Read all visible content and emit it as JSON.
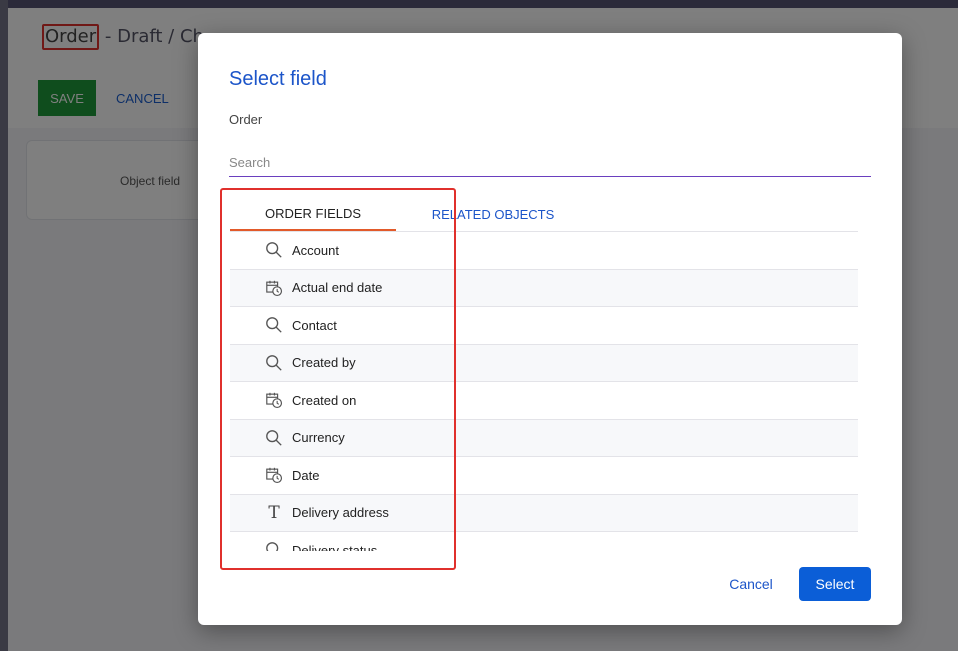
{
  "background": {
    "title_prefix": "Order",
    "title_rest": " - Draft / Ch",
    "save_label": "SAVE",
    "cancel_label": "CANCEL",
    "card_label": "Object field"
  },
  "dialog": {
    "title": "Select field",
    "subtitle": "Order",
    "search_placeholder": "Search",
    "tabs": [
      {
        "label": "ORDER FIELDS",
        "active": true
      },
      {
        "label": "RELATED OBJECTS",
        "active": false
      }
    ],
    "fields": [
      {
        "label": "Account",
        "icon": "search-icon"
      },
      {
        "label": "Actual end date",
        "icon": "calendar-clock-icon"
      },
      {
        "label": "Contact",
        "icon": "search-icon"
      },
      {
        "label": "Created by",
        "icon": "search-icon"
      },
      {
        "label": "Created on",
        "icon": "calendar-clock-icon"
      },
      {
        "label": "Currency",
        "icon": "search-icon"
      },
      {
        "label": "Date",
        "icon": "calendar-clock-icon"
      },
      {
        "label": "Delivery address",
        "icon": "text-icon"
      },
      {
        "label": "Delivery status",
        "icon": "search-icon"
      }
    ],
    "cancel_label": "Cancel",
    "select_label": "Select"
  },
  "colors": {
    "accent": "#1c55c9",
    "primary_button": "#0b5ed7",
    "save_button": "#1e9b3a",
    "highlight": "#e0302c",
    "tab_underline": "#e25a2a",
    "search_underline": "#6a3fbf"
  }
}
